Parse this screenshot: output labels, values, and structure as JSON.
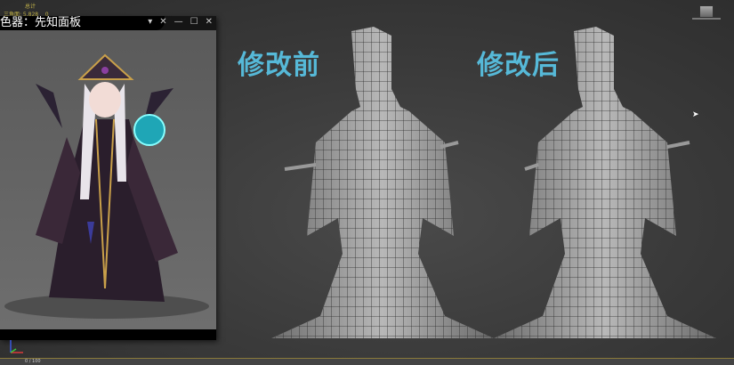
{
  "stats": {
    "label": "总计",
    "triangles": "三角面: 5,828",
    "extra": "0"
  },
  "reference_window": {
    "title": "色器：先知面板",
    "controls": [
      "▾",
      "✕",
      "—",
      "☐",
      "✕"
    ]
  },
  "labels": {
    "before": "修改前",
    "after": "修改后"
  },
  "statusbar": {
    "frame": "0 / 100"
  },
  "colors": {
    "label": "#56b9d8",
    "stats": "#c8b84a"
  }
}
